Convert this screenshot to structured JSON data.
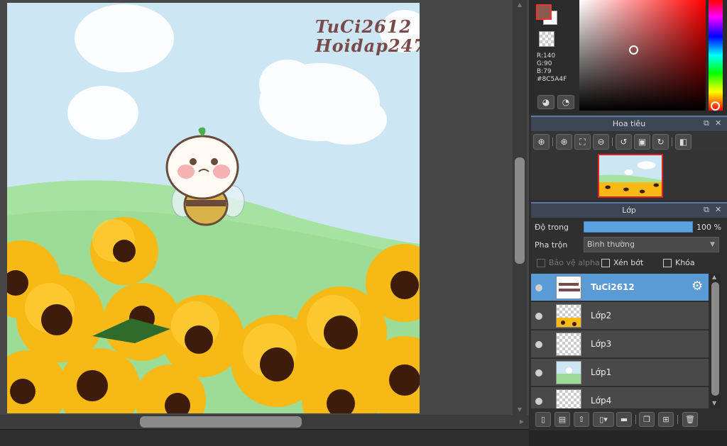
{
  "canvas": {
    "watermark_line1": "TuCi2612",
    "watermark_line2": "Hoidap247"
  },
  "color": {
    "foreground_hex": "#8C5A4F",
    "background_hex": "#FFFFFF",
    "r_label": "R:140",
    "g_label": "G:90",
    "b_label": "B:79",
    "hex_label": "#8C5A4F"
  },
  "navigator": {
    "title": "Hoa tiêu"
  },
  "layers_panel": {
    "title": "Lớp",
    "opacity_label": "Độ trong",
    "opacity_value": "100 %",
    "opacity_fraction": 1.0,
    "blend_label": "Pha trộn",
    "blend_value": "Bình thường",
    "protect_alpha_label": "Bảo vệ alpha",
    "clipping_label": "Xén bớt",
    "lock_label": "Khóa",
    "layers": [
      {
        "name": "TuCi2612",
        "selected": true,
        "thumb": "text"
      },
      {
        "name": "Lớp2",
        "selected": false,
        "thumb": "sunflowers"
      },
      {
        "name": "Lớp3",
        "selected": false,
        "thumb": "transparent"
      },
      {
        "name": "Lớp1",
        "selected": false,
        "thumb": "scene"
      },
      {
        "name": "Lớp4",
        "selected": false,
        "thumb": "transparent"
      }
    ]
  },
  "colors": {
    "accent_blue": "#5B9BD5",
    "selection_red": "#E02020"
  }
}
